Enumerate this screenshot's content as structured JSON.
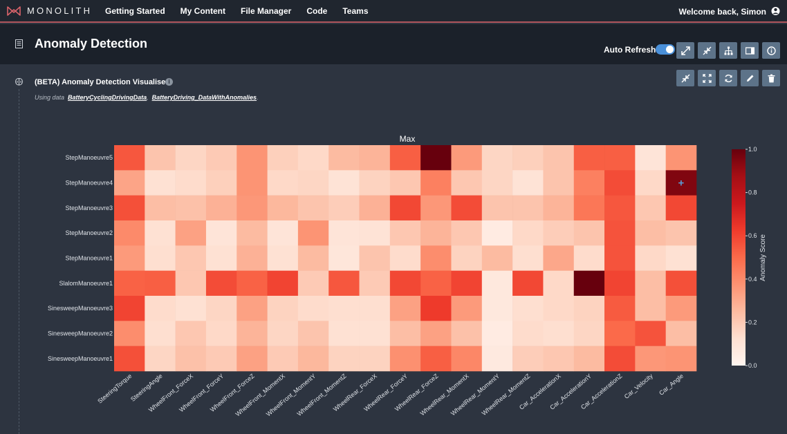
{
  "nav": {
    "brand": "MONOLITH",
    "links": [
      "Getting Started",
      "My Content",
      "File Manager",
      "Code",
      "Teams"
    ],
    "welcome": "Welcome back, Simon"
  },
  "header": {
    "title": "Anomaly Detection",
    "auto_refresh_label": "Auto Refresh",
    "auto_refresh_on": true
  },
  "panel": {
    "title": "(BETA) Anomaly Detection Visualiser",
    "using_prefix": "Using data",
    "datasets": [
      "BatteryCyclingDrivingData",
      "BatteryDriving_DataWithAnomalies"
    ],
    "separator": ",",
    "trailer": "."
  },
  "colors": {
    "accent": "#4a90d9",
    "nav_underline": "#b0555c",
    "button": "#5d7389",
    "heat_low": "#fff5f0",
    "heat_high": "#67000d"
  },
  "chart_data": {
    "type": "heatmap",
    "title": "Max",
    "colorbar_label": "Anomaly Score",
    "colorbar_ticks": [
      "1.0",
      "0.8",
      "0.6",
      "0.4",
      "0.2",
      "0.0"
    ],
    "vmin": 0,
    "vmax": 1,
    "rows": [
      "StepManoeuvre5",
      "StepManoeuvre4",
      "StepManoeuvre3",
      "StepManoeuvre2",
      "StepManoeuvre1",
      "SlalomManoeuvre1",
      "SinesweepManoeuvre3",
      "SinesweepManoeuvre2",
      "SinesweepManoeuvre1"
    ],
    "columns": [
      "SteeringTorque",
      "SteeringAngle",
      "WheelFront_ForceX",
      "WheelFront_ForceY",
      "WheelFront_ForceZ",
      "WheelFront_MomentX",
      "WheelFront_MomentY",
      "WheelFront_MomentZ",
      "WheelRear_ForceX",
      "WheelRear_ForceY",
      "WheelRear_ForceZ",
      "WheelRear_MomentX",
      "WheelRear_MomentY",
      "WheelRear_MomentZ",
      "Car_AccelerationX",
      "Car_AccelerationY",
      "Car_AccelerationZ",
      "Car_Velocity",
      "Car_Angle"
    ],
    "values": [
      [
        0.55,
        0.22,
        0.16,
        0.2,
        0.37,
        0.18,
        0.15,
        0.25,
        0.27,
        0.53,
        1.0,
        0.35,
        0.16,
        0.18,
        0.22,
        0.53,
        0.53,
        0.1,
        0.37
      ],
      [
        0.32,
        0.12,
        0.14,
        0.18,
        0.37,
        0.15,
        0.16,
        0.11,
        0.17,
        0.21,
        0.43,
        0.21,
        0.16,
        0.11,
        0.22,
        0.43,
        0.58,
        0.15,
        0.95
      ],
      [
        0.57,
        0.24,
        0.23,
        0.28,
        0.36,
        0.26,
        0.22,
        0.19,
        0.28,
        0.59,
        0.36,
        0.58,
        0.22,
        0.22,
        0.27,
        0.46,
        0.55,
        0.21,
        0.59
      ],
      [
        0.4,
        0.12,
        0.33,
        0.1,
        0.25,
        0.1,
        0.37,
        0.1,
        0.11,
        0.21,
        0.27,
        0.21,
        0.06,
        0.15,
        0.19,
        0.22,
        0.56,
        0.24,
        0.22
      ],
      [
        0.35,
        0.13,
        0.21,
        0.12,
        0.28,
        0.12,
        0.25,
        0.09,
        0.22,
        0.14,
        0.39,
        0.17,
        0.25,
        0.13,
        0.31,
        0.14,
        0.56,
        0.15,
        0.12
      ],
      [
        0.52,
        0.53,
        0.21,
        0.58,
        0.52,
        0.6,
        0.2,
        0.55,
        0.2,
        0.59,
        0.52,
        0.6,
        0.08,
        0.59,
        0.15,
        1.0,
        0.6,
        0.24,
        0.57
      ],
      [
        0.6,
        0.14,
        0.12,
        0.16,
        0.33,
        0.17,
        0.14,
        0.13,
        0.13,
        0.33,
        0.63,
        0.35,
        0.08,
        0.13,
        0.15,
        0.17,
        0.54,
        0.24,
        0.35
      ],
      [
        0.39,
        0.13,
        0.21,
        0.15,
        0.27,
        0.16,
        0.22,
        0.12,
        0.12,
        0.24,
        0.33,
        0.23,
        0.06,
        0.14,
        0.13,
        0.16,
        0.5,
        0.56,
        0.24
      ],
      [
        0.57,
        0.16,
        0.23,
        0.2,
        0.33,
        0.2,
        0.26,
        0.17,
        0.17,
        0.38,
        0.53,
        0.41,
        0.07,
        0.19,
        0.21,
        0.25,
        0.58,
        0.36,
        0.37
      ]
    ],
    "marker": {
      "row": "StepManoeuvre4",
      "column": "Car_Angle",
      "symbol": "+"
    }
  }
}
